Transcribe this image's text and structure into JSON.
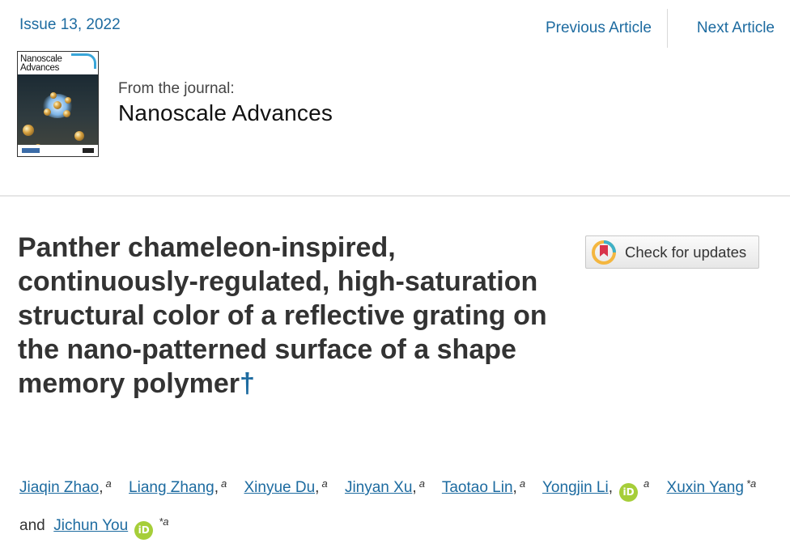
{
  "issue_label": "Issue 13, 2022",
  "nav": {
    "previous": "Previous Article",
    "next": "Next Article"
  },
  "cover": {
    "title": "Nanoscale\nAdvances"
  },
  "journal": {
    "from_label": "From the journal:",
    "name": "Nanoscale Advances"
  },
  "article": {
    "title": "Panther chameleon-inspired, continuously-regulated, high-saturation structural color of a reflective grating on the nano-patterned surface of a shape memory polymer",
    "dagger": "†"
  },
  "check_updates": {
    "label": "Check for updates"
  },
  "authors": {
    "list": [
      {
        "name": "Jiaqin Zhao",
        "mark": "a"
      },
      {
        "name": "Liang Zhang",
        "mark": "a"
      },
      {
        "name": "Xinyue Du",
        "mark": "a"
      },
      {
        "name": "Jinyan Xu",
        "mark": "a"
      },
      {
        "name": "Taotao Lin",
        "mark": "a"
      },
      {
        "name": "Yongjin Li",
        "mark": "a"
      },
      {
        "name": "Xuxin Yang",
        "mark": "*a"
      },
      {
        "name": "Jichun You",
        "mark": "*a"
      }
    ],
    "and_label": "and",
    "orcid_label": "iD"
  },
  "colors": {
    "link": "#1d6ba0",
    "orcid": "#a6ce39"
  }
}
